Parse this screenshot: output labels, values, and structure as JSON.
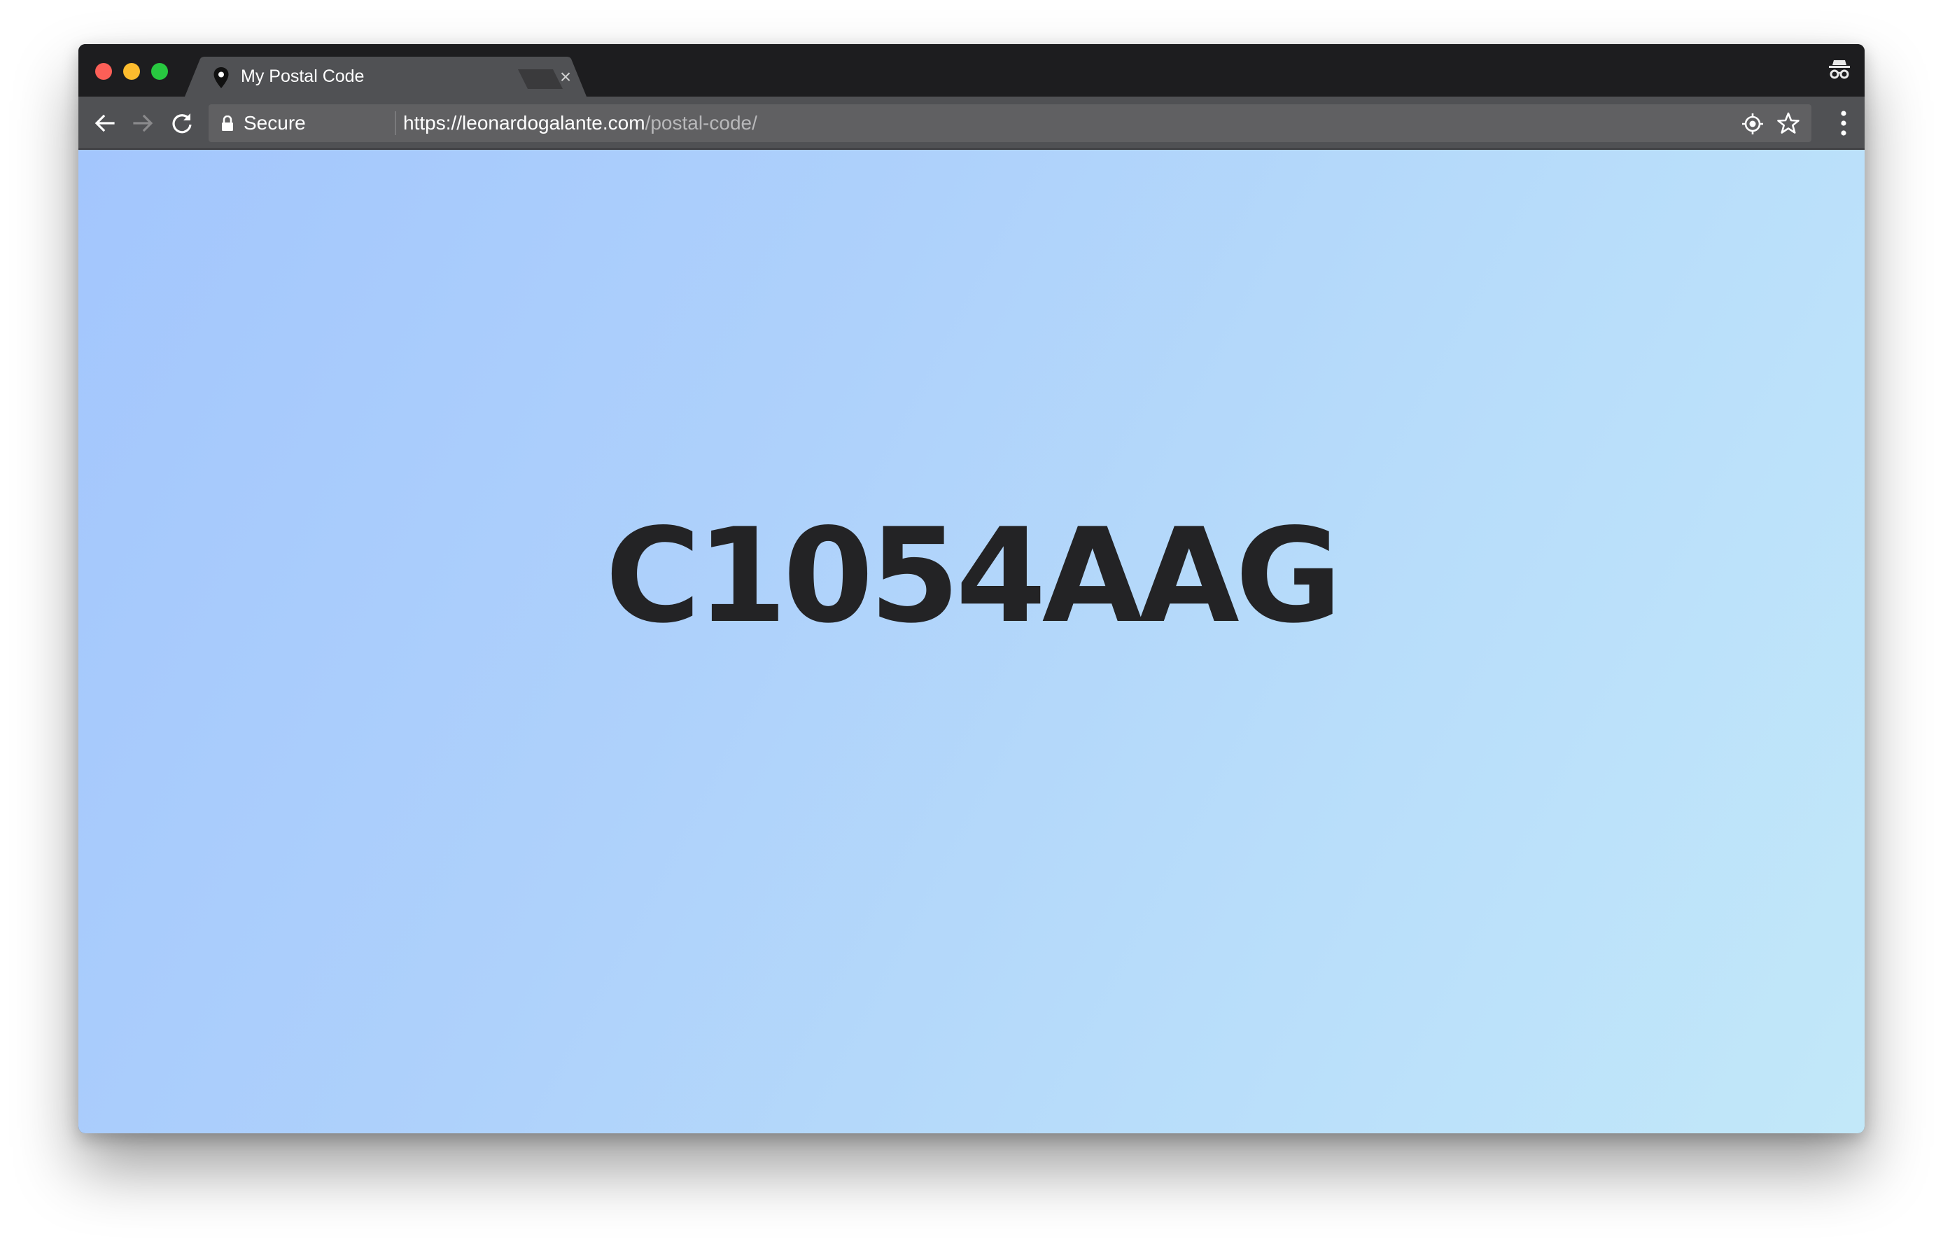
{
  "browser": {
    "tab": {
      "title": "My Postal Code",
      "favicon": "map-pin-icon",
      "close_glyph": "×"
    },
    "toolbar": {
      "security_label": "Secure",
      "url_host": "https://leonardogalante.com",
      "url_path": "/postal-code/"
    },
    "icons": {
      "back": "arrow-left-icon",
      "forward": "arrow-right-icon",
      "reload": "reload-icon",
      "lock": "lock-icon",
      "location": "location-target-icon",
      "bookmark": "star-icon",
      "menu": "kebab-menu-icon",
      "incognito": "incognito-icon"
    },
    "colors": {
      "traffic_close": "#fc5f57",
      "traffic_minimize": "#fdbc2e",
      "traffic_maximize": "#28c840",
      "gradient_start": "#a3c6fd",
      "gradient_end": "#c2e8f9",
      "text_dark": "#232325"
    }
  },
  "page": {
    "postal_code": "C1054AAG"
  }
}
